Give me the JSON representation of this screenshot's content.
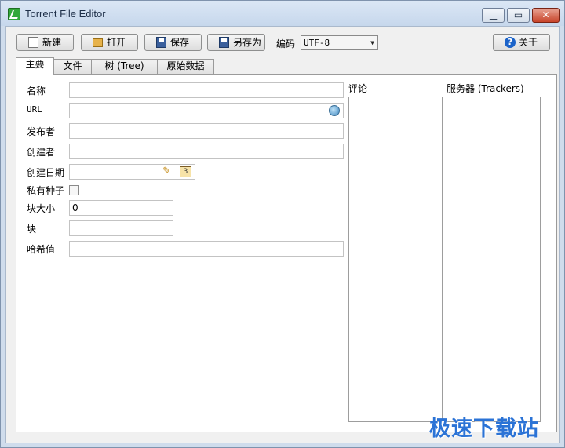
{
  "window": {
    "title": "Torrent File Editor"
  },
  "toolbar": {
    "new_label": "新建",
    "open_label": "打开",
    "save_label": "保存",
    "save_as_label": "另存为",
    "encoding_label": "编码",
    "encoding_value": "UTF-8",
    "about_label": "关于"
  },
  "tabs": [
    {
      "label": "主要",
      "active": true
    },
    {
      "label": "文件"
    },
    {
      "label": "树 (Tree)"
    },
    {
      "label": "原始数据"
    }
  ],
  "form": {
    "name_label": "名称",
    "url_label": "URL",
    "publisher_label": "发布者",
    "creator_label": "创建者",
    "creation_date_label": "创建日期",
    "private_label": "私有种子",
    "piece_size_label": "块大小",
    "piece_size_value": "0",
    "pieces_label": "块",
    "hash_label": "哈希值",
    "private_checked": false
  },
  "comment": {
    "label": "评论"
  },
  "trackers": {
    "label": "服务器 (Trackers)"
  },
  "watermark": {
    "text": "极速下载站"
  },
  "icons": {
    "app": "torrent-app-icon",
    "new": "new-file-icon",
    "open": "folder-open-icon",
    "save": "floppy-disk-icon",
    "save_as": "floppy-disk-icon",
    "about": "help-icon",
    "url_action": "globe-icon",
    "date_clear": "broom-icon",
    "date_pick": "calendar-icon"
  }
}
